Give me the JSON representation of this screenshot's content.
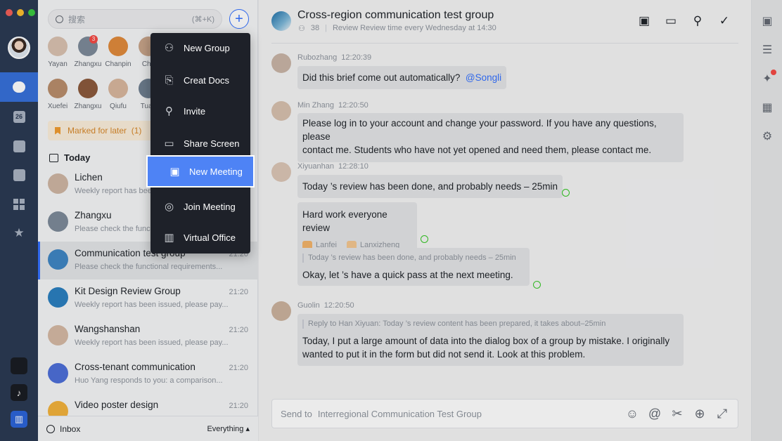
{
  "window": {
    "traffic_colors": [
      "#f25f58",
      "#fbbe2e",
      "#3ac93f"
    ]
  },
  "rail": {
    "items": [
      {
        "icon": "message-icon",
        "glyph": "✎",
        "active": true
      },
      {
        "icon": "calendar-icon",
        "glyph": "26"
      },
      {
        "icon": "docs-icon",
        "glyph": "▤"
      },
      {
        "icon": "contacts-icon",
        "glyph": "▣"
      },
      {
        "icon": "workplace-icon",
        "glyph": "▦"
      },
      {
        "icon": "favorites-icon",
        "glyph": "★"
      }
    ],
    "apps": [
      {
        "icon": "app-dark-icon",
        "glyph": ""
      },
      {
        "icon": "tiktok-icon",
        "glyph": "♪"
      },
      {
        "icon": "analytics-icon",
        "glyph": "▥"
      }
    ]
  },
  "search": {
    "placeholder": "搜索",
    "shortcut": "(⌘+K)"
  },
  "contacts": [
    {
      "name": "Yayan",
      "color": "#d9c2b0"
    },
    {
      "name": "Zhangxu",
      "color": "#7d8a99",
      "badge": "3"
    },
    {
      "name": "Chanpin",
      "color": "#e08a3c"
    },
    {
      "name": "Chu",
      "color": "#c9a58a"
    },
    {
      "name": "Xuefei",
      "color": "#b98e6c"
    },
    {
      "name": "Zhangxu",
      "color": "#8b5a3c"
    },
    {
      "name": "Qiufu",
      "color": "#d8b79e"
    },
    {
      "name": "Tuan",
      "color": "#6f7f91"
    }
  ],
  "marked": {
    "label": "Marked for later",
    "count": "(1)"
  },
  "today_label": "Today",
  "conversations": [
    {
      "name": "Lichen",
      "sub": "Weekly report has been",
      "time": "",
      "color": "#cfb6a3"
    },
    {
      "name": "Zhangxu",
      "sub": "Please check the func",
      "time": "",
      "color": "#7d8a99"
    },
    {
      "name": "Communication test group",
      "sub": "Please check the functional requirements...",
      "time": "21:20",
      "color": "#3f86c4",
      "selected": true
    },
    {
      "name": "Kit Design Review Group",
      "sub": "Weekly report has been issued, please pay...",
      "time": "21:20",
      "color": "#2b7fbf"
    },
    {
      "name": "Wangshanshan",
      "sub": "Weekly report has been issued, please pay...",
      "time": "21:20",
      "color": "#d5b9a4"
    },
    {
      "name": "Cross-tenant communication",
      "sub": "Huo Yang responds to you: a comparison...",
      "time": "21:20",
      "color": "#4e6fd8"
    },
    {
      "name": "Video poster design",
      "sub": "",
      "time": "21:20",
      "color": "#f2b23c"
    }
  ],
  "footer": {
    "inbox": "Inbox",
    "filter": "Everything ▴"
  },
  "menu": [
    {
      "label": "New Group",
      "icon": "group-icon",
      "glyph": "⚇"
    },
    {
      "label": "Creat Docs",
      "icon": "new-doc-icon",
      "glyph": "⎘"
    },
    {
      "label": "Invite",
      "icon": "invite-icon",
      "glyph": "⚲"
    },
    {
      "label": "Share Screen",
      "icon": "share-screen-icon",
      "glyph": "▭"
    },
    {
      "label": "New Meeting",
      "icon": "video-icon",
      "glyph": "▣",
      "highlighted": true
    },
    {
      "label": "Join Meeting",
      "icon": "join-meeting-icon",
      "glyph": "◎"
    },
    {
      "label": "Virtual Office",
      "icon": "virtual-office-icon",
      "glyph": "▥"
    }
  ],
  "chat": {
    "title": "Cross-region communication test group",
    "member_count": "38",
    "review_note": "Review Review time every Wednesday at 14:30",
    "header_icons": [
      {
        "name": "board-icon",
        "glyph": "▣"
      },
      {
        "name": "video-call-icon",
        "glyph": "▭"
      },
      {
        "name": "add-member-icon",
        "glyph": "⚲"
      },
      {
        "name": "done-icon",
        "glyph": "✓"
      }
    ],
    "messages": {
      "m1": {
        "sender": "Rubozhang",
        "time": "12:20:39",
        "text": "Did this brief come out automatically?",
        "mention": "@Songli"
      },
      "m2": {
        "sender": "Min Zhang",
        "time": "12:20:50",
        "line1": "Please log in to your account and change your password. If you have any questions, please",
        "line2": "contact me. Students who have not yet opened and need them, please contact me."
      },
      "m3": {
        "sender": "Xiyuanhan",
        "time": "12:28:10",
        "text1": "Today ’s review has been done, and probably needs – 25min",
        "text2": "Hard work everyone review",
        "react1": "Lanfei",
        "react2": "Lanxizheng",
        "quote": "Today ’s review has been done, and probably needs – 25min",
        "text3": "Okay, let ’s have a quick pass at the next meeting."
      },
      "m4": {
        "sender": "Guolin",
        "time": "12:20:50",
        "quote": "Reply to Han Xiyuan: Today ’s review content has been prepared, it takes about–25min",
        "line1": "Today, I put a large amount of data into the dialog box of a group by mistake. I originally",
        "line2": "wanted to put it in the form but did not send it. Look at this problem."
      }
    },
    "composer": {
      "prefix": "Send to",
      "target": "Interregional Communication Test Group"
    },
    "composer_tools": [
      {
        "name": "emoji-icon",
        "glyph": "☺"
      },
      {
        "name": "mention-icon",
        "glyph": "@"
      },
      {
        "name": "scissors-icon",
        "glyph": "✂"
      },
      {
        "name": "add-icon",
        "glyph": "⊕"
      },
      {
        "name": "expand-icon",
        "glyph": "⤢"
      }
    ]
  },
  "right_rail": [
    {
      "name": "briefcase-icon",
      "glyph": "▣"
    },
    {
      "name": "search-history-icon",
      "glyph": "☰"
    },
    {
      "name": "pin-icon",
      "glyph": "✦"
    },
    {
      "name": "calendar-add-icon",
      "glyph": "▦"
    },
    {
      "name": "settings-icon",
      "glyph": "⚙"
    }
  ]
}
